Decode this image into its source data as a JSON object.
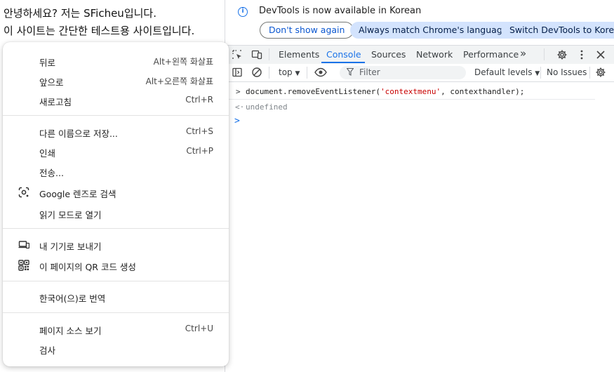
{
  "page": {
    "line1": "안녕하세요? 저는 SFicheu입니다.",
    "line2": "이 사이트는 간단한 테스트용 사이트입니다."
  },
  "context_menu": {
    "back": {
      "label": "뒤로",
      "shortcut": "Alt+왼쪽 화살표"
    },
    "forward": {
      "label": "앞으로",
      "shortcut": "Alt+오른쪽 화살표"
    },
    "reload": {
      "label": "새로고침",
      "shortcut": "Ctrl+R"
    },
    "save_as": {
      "label": "다른 이름으로 저장...",
      "shortcut": "Ctrl+S"
    },
    "print": {
      "label": "인쇄",
      "shortcut": "Ctrl+P"
    },
    "cast": {
      "label": "전송..."
    },
    "google_lens": {
      "label": "Google 렌즈로 검색"
    },
    "reading_mode": {
      "label": "읽기 모드로 열기"
    },
    "send_to_devices": {
      "label": "내 기기로 보내기"
    },
    "qr_code": {
      "label": "이 페이지의 QR 코드 생성"
    },
    "translate": {
      "label": "한국어(으)로 번역"
    },
    "view_source": {
      "label": "페이지 소스 보기",
      "shortcut": "Ctrl+U"
    },
    "inspect": {
      "label": "검사"
    }
  },
  "devtools": {
    "infobar": {
      "message": "DevTools is now available in Korean",
      "dont_show": "Don't show again",
      "always_match": "Always match Chrome's language",
      "switch": "Switch DevTools to Korean"
    },
    "tabs": [
      "Elements",
      "Console",
      "Sources",
      "Network",
      "Performance"
    ],
    "more_tabs": "»",
    "console_toolbar": {
      "context": "top",
      "filter_placeholder": "Filter",
      "levels": "Default levels",
      "issues": "No Issues"
    },
    "console": {
      "input_prompt": ">",
      "input_pre": "document.removeEventListener(",
      "input_str": "'contextmenu'",
      "input_post": ", contexthandler);",
      "result_prompt": "<·",
      "result": "undefined",
      "caret": ">"
    }
  },
  "colors": {
    "accent": "#1a73e8",
    "pill_filled_bg": "#d3e3fd",
    "string_red": "#c80000"
  }
}
